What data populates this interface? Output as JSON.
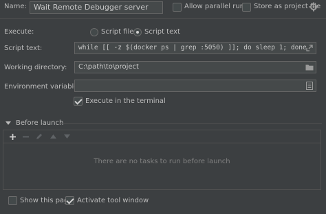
{
  "name": {
    "label": "Name:",
    "value": "Wait Remote Debugger server"
  },
  "options": {
    "allow_parallel_run": {
      "label": "Allow parallel run",
      "checked": false
    },
    "store_as_project_file": {
      "label": "Store as project file",
      "checked": false
    }
  },
  "execute": {
    "label": "Execute:",
    "options": [
      {
        "label": "Script file",
        "selected": false
      },
      {
        "label": "Script text",
        "selected": true
      }
    ]
  },
  "script_text": {
    "label": "Script text:",
    "value": "while [[ -z $(docker ps | grep :5050) ]]; do sleep 1; done"
  },
  "working_directory": {
    "label": "Working directory:",
    "value": "C:\\path\\to\\project",
    "icon": "folder-icon"
  },
  "environment_variables": {
    "label": "Environment variables:",
    "value": "",
    "icon": "edit-list-icon"
  },
  "execute_in_terminal": {
    "label": "Execute in the terminal",
    "checked": true
  },
  "before_launch": {
    "label": "Before launch",
    "toolbar": [
      "add-icon",
      "remove-icon",
      "edit-icon",
      "move-up-icon",
      "move-down-icon"
    ],
    "empty_text": "There are no tasks to run before launch"
  },
  "footer": {
    "show_this_page": {
      "label": "Show this page",
      "checked": false
    },
    "activate_tool_window": {
      "label": "Activate tool window",
      "checked": true
    }
  }
}
